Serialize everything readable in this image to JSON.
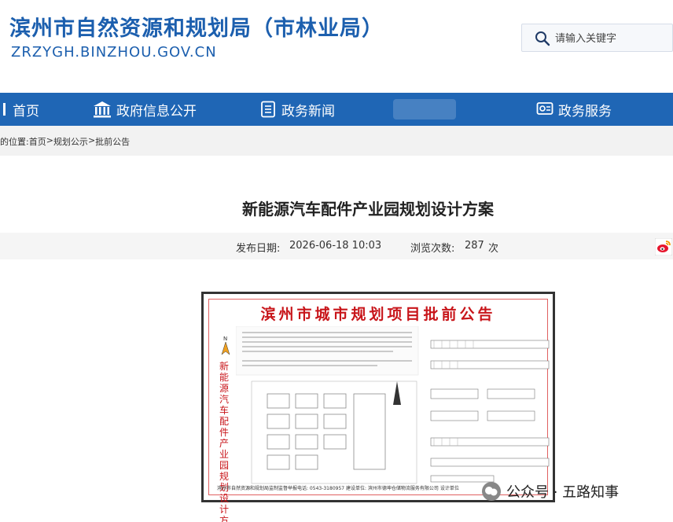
{
  "header": {
    "title": "滨州市自然资源和规划局（市林业局）",
    "domain": "ZRZYGH.BINZHOU.GOV.CN",
    "search_placeholder": "请输入关键字"
  },
  "nav": {
    "items": [
      {
        "label": "首页",
        "icon": "home-icon"
      },
      {
        "label": "政府信息公开",
        "icon": "government-building-icon"
      },
      {
        "label": "政务新闻",
        "icon": "news-document-icon"
      },
      {
        "label": "政务服务",
        "icon": "service-window-icon"
      }
    ]
  },
  "breadcrumb": {
    "prefix": "的位置:",
    "items": [
      "首页",
      "规划公示",
      "批前公告"
    ],
    "separator": ">"
  },
  "article": {
    "title": "新能源汽车配件产业园规划设计方案",
    "publish_label": "发布日期:",
    "publish_date": "2026-06-18 10:03",
    "views_label": "浏览次数:",
    "views_count": "287",
    "views_unit": "次"
  },
  "notice": {
    "title": "滨州市城市规划项目批前公告",
    "vertical_text": "新能源汽车配件产业园规划设计方案",
    "footer": "滨州市自然资源和规划局监制监督举报电话: 0543-3180957   建设单位: 滨州市德坤仓储物流服务有限公司   设计单位"
  },
  "watermark": {
    "text": "公众号 · 五路知事"
  },
  "colors": {
    "brand_blue": "#1f66b5",
    "title_blue": "#1c5fae",
    "notice_red": "#c8151a"
  }
}
